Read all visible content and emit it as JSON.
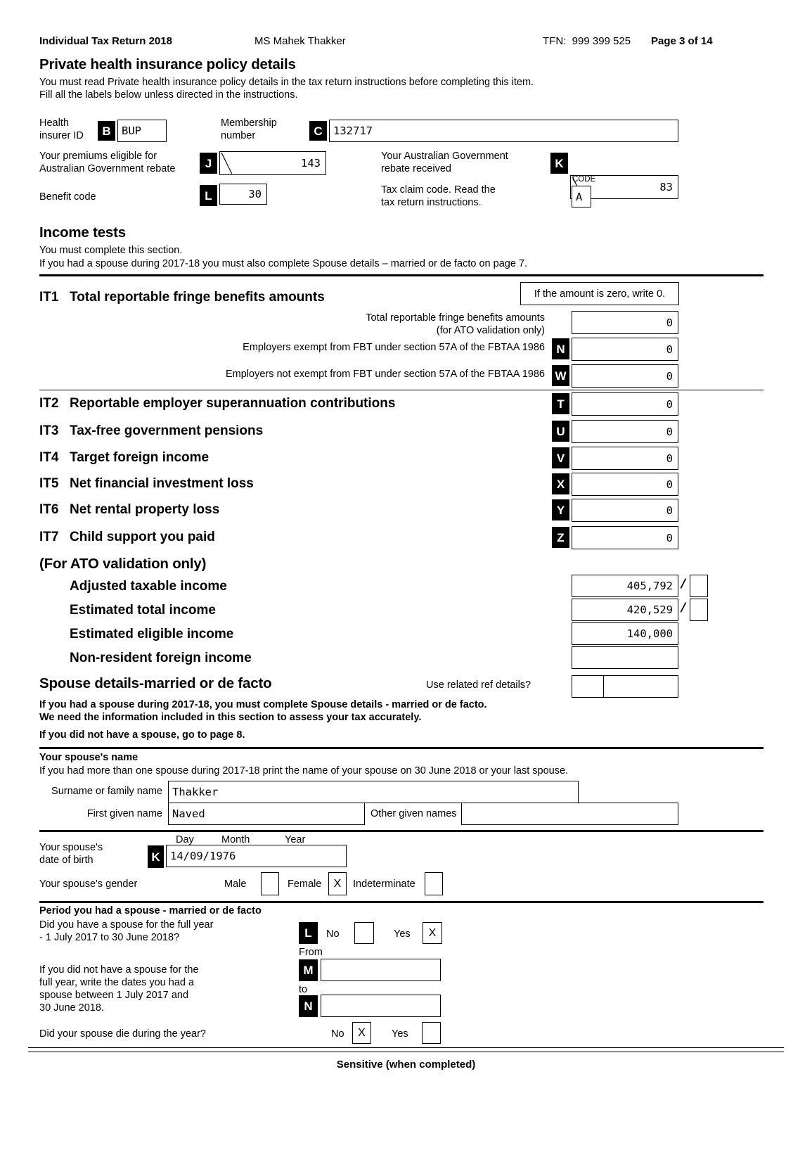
{
  "header": {
    "form_title": "Individual Tax Return 2018",
    "taxpayer_name": "MS Mahek Thakker",
    "tfn_label": "TFN:",
    "tfn_value": "999 399 525",
    "page_label": "Page 3 of 14"
  },
  "phi": {
    "heading": "Private health insurance policy details",
    "intro_line1": "You must read Private health insurance policy details in the tax return instructions before completing this item.",
    "intro_line2": "Fill all the labels below unless directed in the instructions.",
    "insurer_label_l1": "Health",
    "insurer_label_l2": "insurer ID",
    "insurer_tag": "B",
    "insurer_value": "BUP",
    "membership_label_l1": "Membership",
    "membership_label_l2": "number",
    "membership_tag": "C",
    "membership_value": "132717",
    "premiums_label_l1": "Your premiums eligible for",
    "premiums_label_l2": "Australian Government rebate",
    "premiums_tag": "J",
    "premiums_value": "143",
    "rebate_label_l1": "Your Australian Government",
    "rebate_label_l2": "rebate  received",
    "rebate_tag": "K",
    "rebate_value": "83",
    "code_label": "CODE",
    "benefit_label": "Benefit code",
    "benefit_tag": "L",
    "benefit_value": "30",
    "taxclaim_label_l1": "Tax claim code. Read the",
    "taxclaim_label_l2": "tax  return  instructions.",
    "taxclaim_value": "A"
  },
  "income_tests": {
    "heading": "Income tests",
    "intro_line1": "You must complete this section.",
    "intro_line2": "If you had a spouse during 2017-18 you must also complete Spouse details – married or de facto on page 7.",
    "zero_note": "If the amount is zero, write 0.",
    "it1": {
      "code": "IT1",
      "label": "Total reportable fringe benefits amounts",
      "sub1_l1": "Total reportable fringe benefits amounts",
      "sub1_l2": "(for ATO validation only)",
      "sub1_value": "0",
      "sub2_label": "Employers exempt from FBT under section 57A of the FBTAA 1986",
      "sub2_tag": "N",
      "sub2_value": "0",
      "sub3_label": "Employers not exempt from FBT under section 57A of the FBTAA 1986",
      "sub3_tag": "W",
      "sub3_value": "0"
    },
    "rows": [
      {
        "code": "IT2",
        "label": "Reportable employer superannuation contributions",
        "tag": "T",
        "value": "0"
      },
      {
        "code": "IT3",
        "label": "Tax-free government pensions",
        "tag": "U",
        "value": "0"
      },
      {
        "code": "IT4",
        "label": "Target foreign income",
        "tag": "V",
        "value": "0"
      },
      {
        "code": "IT5",
        "label": "Net financial investment loss",
        "tag": "X",
        "value": "0"
      },
      {
        "code": "IT6",
        "label": "Net rental property loss",
        "tag": "Y",
        "value": "0"
      },
      {
        "code": "IT7",
        "label": "Child support you paid",
        "tag": "Z",
        "value": "0"
      }
    ]
  },
  "ato_validation": {
    "heading": "(For ATO validation only)",
    "rows": [
      {
        "label": "Adjusted taxable income",
        "value": "405,792",
        "has_cents": true,
        "cents": ""
      },
      {
        "label": "Estimated total income",
        "value": "420,529",
        "has_cents": true,
        "cents": ""
      },
      {
        "label": "Estimated eligible income",
        "value": "140,000",
        "has_cents": false,
        "cents": ""
      },
      {
        "label": "Non-resident foreign income",
        "value": "",
        "has_cents": false,
        "cents": ""
      }
    ],
    "separator": "/"
  },
  "spouse": {
    "heading": "Spouse details-married or de facto",
    "related_ref_label": "Use related ref details?",
    "related_ref_code": "",
    "related_ref_value": "",
    "note_line1": "If you had a spouse during 2017-18, you must complete Spouse details - married or de facto.",
    "note_line2": "We need the information included in this section to assess your tax accurately.",
    "note_line3": "If you did not have a spouse, go to page 8.",
    "name_heading": "Your spouse's name",
    "name_note": "If you had more than one spouse during 2017-18 print the name of your spouse on 30 June 2018 or your last spouse.",
    "surname_label": "Surname or family name",
    "surname_value": "Thakker",
    "first_name_label": "First given name",
    "first_name_value": "Naved",
    "other_names_label": "Other given names",
    "other_names_value": "",
    "dob_label_l1": "Your  spouse's",
    "dob_label_l2": "date of birth",
    "dob_tag": "K",
    "dob_value": "14/09/1976",
    "dob_day": "Day",
    "dob_month": "Month",
    "dob_year": "Year",
    "gender_label": "Your  spouse's  gender",
    "gender_male": "Male",
    "gender_male_value": "",
    "gender_female": "Female",
    "gender_female_value": "X",
    "gender_indeterminate": "Indeterminate",
    "gender_indeterminate_value": ""
  },
  "period": {
    "heading": "Period you had a spouse - married or de facto",
    "q1_line1": "Did you have a spouse for the full year",
    "q1_line2": "- 1 July 2017 to 30 June 2018?",
    "q1_tag": "L",
    "q1_no_label": "No",
    "q1_no_value": "",
    "q1_yes_label": "Yes",
    "q1_yes_value": "X",
    "from_label": "From",
    "from_tag": "M",
    "from_value": "",
    "to_label": "to",
    "to_tag": "N",
    "to_value": "",
    "q2_line1": "If you did not have a spouse for the",
    "q2_line2": "full year, write the dates you had a",
    "q2_line3": "spouse between 1 July 2017 and",
    "q2_line4": "30 June 2018.",
    "q3_label": "Did your spouse die during the year?",
    "q3_no_label": "No",
    "q3_no_value": "X",
    "q3_yes_label": "Yes",
    "q3_yes_value": ""
  },
  "footer": {
    "text": "Sensitive (when completed)"
  }
}
